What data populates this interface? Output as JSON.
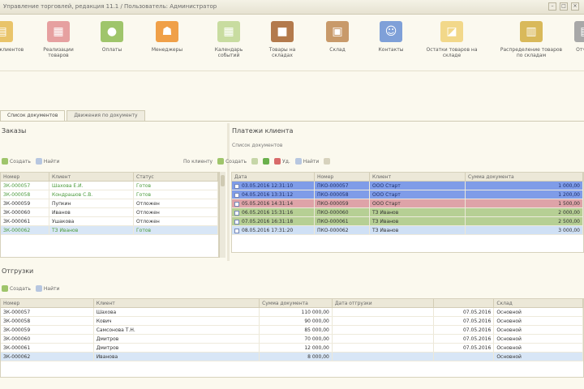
{
  "window": {
    "title": "Управление торговлей, редакция 11.1 / Пользователь: Администратор",
    "buttons": [
      "–",
      "□",
      "×"
    ]
  },
  "toolbar": {
    "items": [
      {
        "label": "Заказы клиентов",
        "icon": "orders-icon",
        "glyph": "▤",
        "color": "#e9c46a"
      },
      {
        "label": "Реализации товаров",
        "icon": "sales-docs-icon",
        "glyph": "▦",
        "color": "#e6a0a0"
      },
      {
        "label": "Оплаты",
        "icon": "payments-icon",
        "glyph": "●",
        "color": "#9fc56b"
      },
      {
        "label": "Менеджеры",
        "icon": "managers-icon",
        "glyph": "☗",
        "color": "#f0a048"
      },
      {
        "label": "Календарь событий",
        "icon": "calendar-icon",
        "glyph": "▦",
        "color": "#c8dca0"
      },
      {
        "label": "Товары на складах",
        "icon": "warehouse-icon",
        "glyph": "■",
        "color": "#b37a4c"
      },
      {
        "label": "Склад",
        "icon": "box-icon",
        "glyph": "▣",
        "color": "#c89a6a"
      },
      {
        "label": "Контакты",
        "icon": "contacts-icon",
        "glyph": "☺",
        "color": "#7fa0d8"
      },
      {
        "label": "Остатки товаров на складе",
        "icon": "stock-icon",
        "glyph": "◪",
        "color": "#f2d88a"
      },
      {
        "label": "Распределение товаров по складам",
        "icon": "distribution-icon",
        "glyph": "▥",
        "color": "#d9b95a"
      },
      {
        "label": "Отчеты",
        "icon": "reports-icon",
        "glyph": "▤",
        "color": "#a8a8a8"
      }
    ]
  },
  "tabs": [
    {
      "label": "Список документов"
    },
    {
      "label": "Движения по документу"
    }
  ],
  "left_pane": {
    "title": "Заказы",
    "toolbar": {
      "create": "Создать",
      "find": "Найти"
    },
    "columns": [
      "Номер",
      "Клиент",
      "Статус"
    ],
    "rows": [
      {
        "c": [
          "ЗК-000057",
          "Шахова Е.И.",
          "Готов"
        ],
        "style": "green"
      },
      {
        "c": [
          "ЗК-000058",
          "Кондрашов С.В.",
          "Готов"
        ],
        "style": "green"
      },
      {
        "c": [
          "ЗК-000059",
          "Пупкин",
          "Отложен"
        ],
        "style": ""
      },
      {
        "c": [
          "ЗК-000060",
          "Иванов",
          "Отложен"
        ],
        "style": ""
      },
      {
        "c": [
          "ЗК-000061",
          "Ушакова",
          "Отложен"
        ],
        "style": ""
      },
      {
        "c": [
          "ЗК-000062",
          "ТЗ Иванов",
          "Готов"
        ],
        "style": "green-sel"
      }
    ]
  },
  "right_pane": {
    "title": "Платежи клиента",
    "subtitle": "Список документов",
    "toolbar": {
      "filter_label": "По клиенту",
      "create": "Создать",
      "del": "Уд.",
      "find": "Найти"
    },
    "columns": [
      "Дата",
      "Номер",
      "Клиент",
      "Сумма документа"
    ],
    "rows": [
      {
        "c": [
          "03.05.2016 12:31:10",
          "ПКО-000057",
          "ООО Старт",
          "1 000,00"
        ],
        "style": "blue"
      },
      {
        "c": [
          "04.05.2016 13:31:12",
          "ПКО-000058",
          "ООО Старт",
          "1 200,00"
        ],
        "style": "blue"
      },
      {
        "c": [
          "05.05.2016 14:31:14",
          "ПКО-000059",
          "ООО Старт",
          "1 500,00"
        ],
        "style": "pink"
      },
      {
        "c": [
          "06.05.2016 15:31:16",
          "ПКО-000060",
          "ТЗ Иванов",
          "2 000,00"
        ],
        "style": "olive"
      },
      {
        "c": [
          "07.05.2016 16:31:18",
          "ПКО-000061",
          "ТЗ Иванов",
          "2 500,00"
        ],
        "style": "olive"
      },
      {
        "c": [
          "08.05.2016 17:31:20",
          "ПКО-000062",
          "ТЗ Иванов",
          "3 000,00"
        ],
        "style": "lightblue"
      }
    ]
  },
  "bottom_pane": {
    "title": "Отгрузки",
    "toolbar": {
      "create": "Создать",
      "find": "Найти"
    },
    "columns": [
      "Номер",
      "Клиент",
      "Сумма документа",
      "Дата отгрузки",
      "",
      "Склад"
    ],
    "rows": [
      {
        "c": [
          "ЗК-000057",
          "Шахова",
          "110 000,00",
          "",
          "07.05.2016",
          "Основной"
        ],
        "style": ""
      },
      {
        "c": [
          "ЗК-000058",
          "Кович",
          "90 000,00",
          "",
          "07.05.2016",
          "Основной"
        ],
        "style": ""
      },
      {
        "c": [
          "ЗК-000059",
          "Самсонова Т.Н.",
          "85 000,00",
          "",
          "07.05.2016",
          "Основной"
        ],
        "style": ""
      },
      {
        "c": [
          "ЗК-000060",
          "Дмитров",
          "70 000,00",
          "",
          "07.05.2016",
          "Основной"
        ],
        "style": ""
      },
      {
        "c": [
          "ЗК-000061",
          "Дмитров",
          "12 000,00",
          "",
          "07.05.2016",
          "Основной"
        ],
        "style": ""
      },
      {
        "c": [
          "ЗК-000062",
          "Иванова",
          "8 000,00",
          "",
          "",
          "Основной"
        ],
        "style": "sel"
      }
    ]
  }
}
